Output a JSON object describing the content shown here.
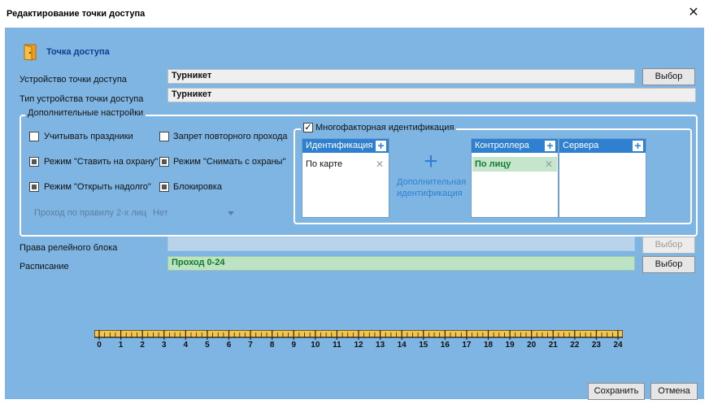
{
  "window": {
    "title": "Редактирование точки доступа",
    "close_glyph": "✕"
  },
  "header": {
    "title": "Точка доступа",
    "icon": "door-icon"
  },
  "fields": {
    "device_label": "Устройство точки доступа",
    "device_value": "Турникет",
    "type_label": "Тип устройства точки доступа",
    "type_value": "Турникет",
    "relay_label": "Права релейного блока",
    "relay_value": "",
    "schedule_label": "Расписание",
    "schedule_value": "Проход 0-24"
  },
  "buttons": {
    "select": "Выбор",
    "save": "Сохранить",
    "cancel": "Отмена"
  },
  "extra_settings": {
    "title": "Дополнительные настройки",
    "options": [
      {
        "label": "Учитывать праздники",
        "state": "unchecked"
      },
      {
        "label": "Запрет повторного прохода",
        "state": "unchecked"
      },
      {
        "label": "Режим \"Ставить на охрану\"",
        "state": "indeterminate"
      },
      {
        "label": "Режим \"Снимать с охраны\"",
        "state": "indeterminate"
      },
      {
        "label": "Режим \"Открыть надолго\"",
        "state": "indeterminate"
      },
      {
        "label": "Блокировка",
        "state": "indeterminate"
      }
    ],
    "two_person_label": "Проход по правилу 2-х лиц",
    "two_person_value": "Нет"
  },
  "mfa": {
    "title": "Многофакторная идентификация",
    "checked": true,
    "identification": {
      "header": "Идентификация",
      "items": [
        "По карте"
      ]
    },
    "additional_label_1": "Дополнительная",
    "additional_label_2": "идентификация",
    "controllers": {
      "header": "Контроллера",
      "items": [
        "По лицу"
      ]
    },
    "servers": {
      "header": "Сервера",
      "items": []
    }
  },
  "ruler": {
    "ticks": [
      "0",
      "1",
      "2",
      "3",
      "4",
      "5",
      "6",
      "7",
      "8",
      "9",
      "10",
      "11",
      "12",
      "13",
      "14",
      "15",
      "16",
      "17",
      "18",
      "19",
      "20",
      "21",
      "22",
      "23",
      "24"
    ],
    "fill_color": "#f3c54a"
  },
  "colors": {
    "accent": "#2f80d1",
    "background": "#7fb5e2",
    "success": "#117a2a"
  }
}
